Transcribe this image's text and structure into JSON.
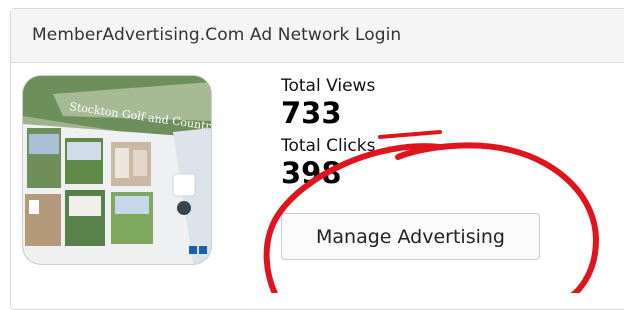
{
  "panel": {
    "title": "MemberAdvertising.Com Ad Network Login"
  },
  "ad_thumbnail": {
    "caption": "Stockton Golf and Country Club"
  },
  "stats": {
    "views_label": "Total Views",
    "views_value": "733",
    "clicks_label": "Total Clicks",
    "clicks_value": "398"
  },
  "actions": {
    "manage_label": "Manage Advertising"
  },
  "colors": {
    "annotation": "#e0141c",
    "header_bg": "#f5f5f5"
  }
}
